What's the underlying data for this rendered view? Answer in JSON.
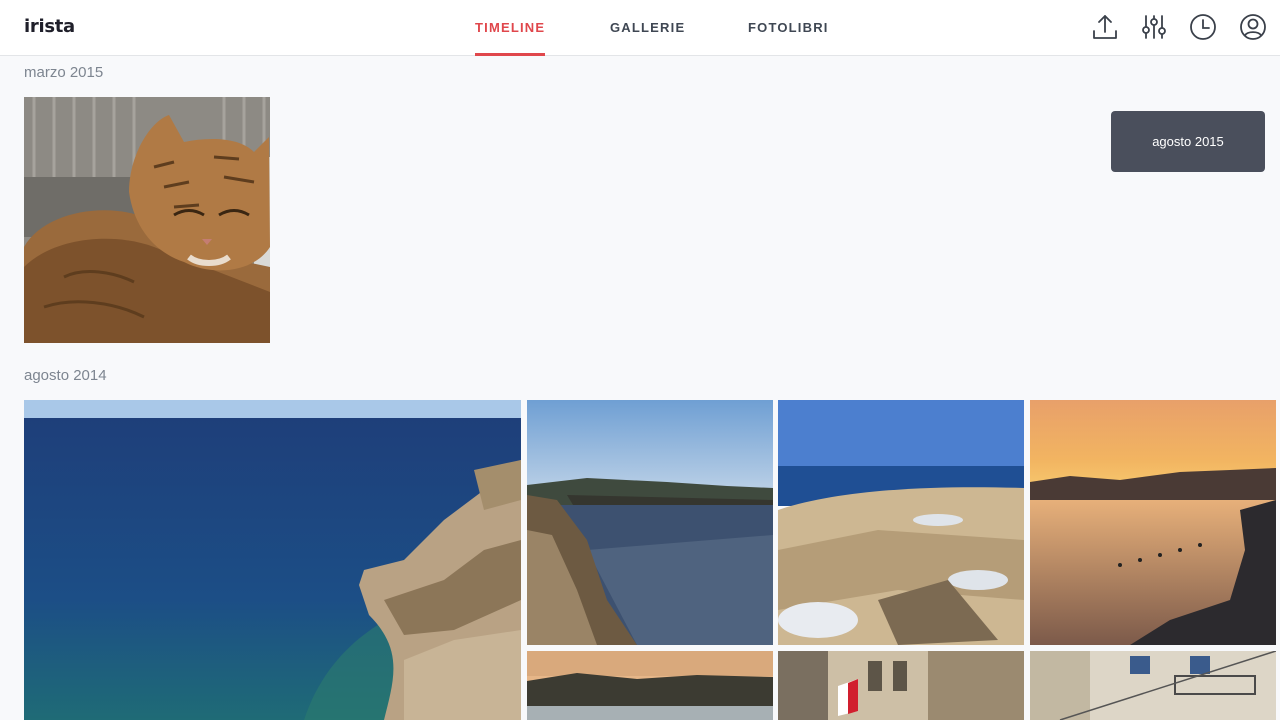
{
  "header": {
    "logo": "irista",
    "tabs": [
      {
        "label": "TIMELINE",
        "active": true
      },
      {
        "label": "GALLERIE",
        "active": false
      },
      {
        "label": "FOTOLIBRI",
        "active": false
      }
    ],
    "icons": [
      "upload-icon",
      "filter-sliders-icon",
      "clock-icon",
      "user-account-icon"
    ],
    "accent_color": "#e0474c"
  },
  "timeline": {
    "date_tooltip": "agosto 2015",
    "sections": [
      {
        "label": "marzo 2015",
        "photos": [
          "cat"
        ]
      },
      {
        "label": "agosto 2014",
        "photos": [
          "sea-cliff",
          "bay-cliff",
          "salt-pans",
          "harbour-sunset",
          "coast-dusk",
          "building-flag",
          "balconies"
        ]
      }
    ]
  }
}
